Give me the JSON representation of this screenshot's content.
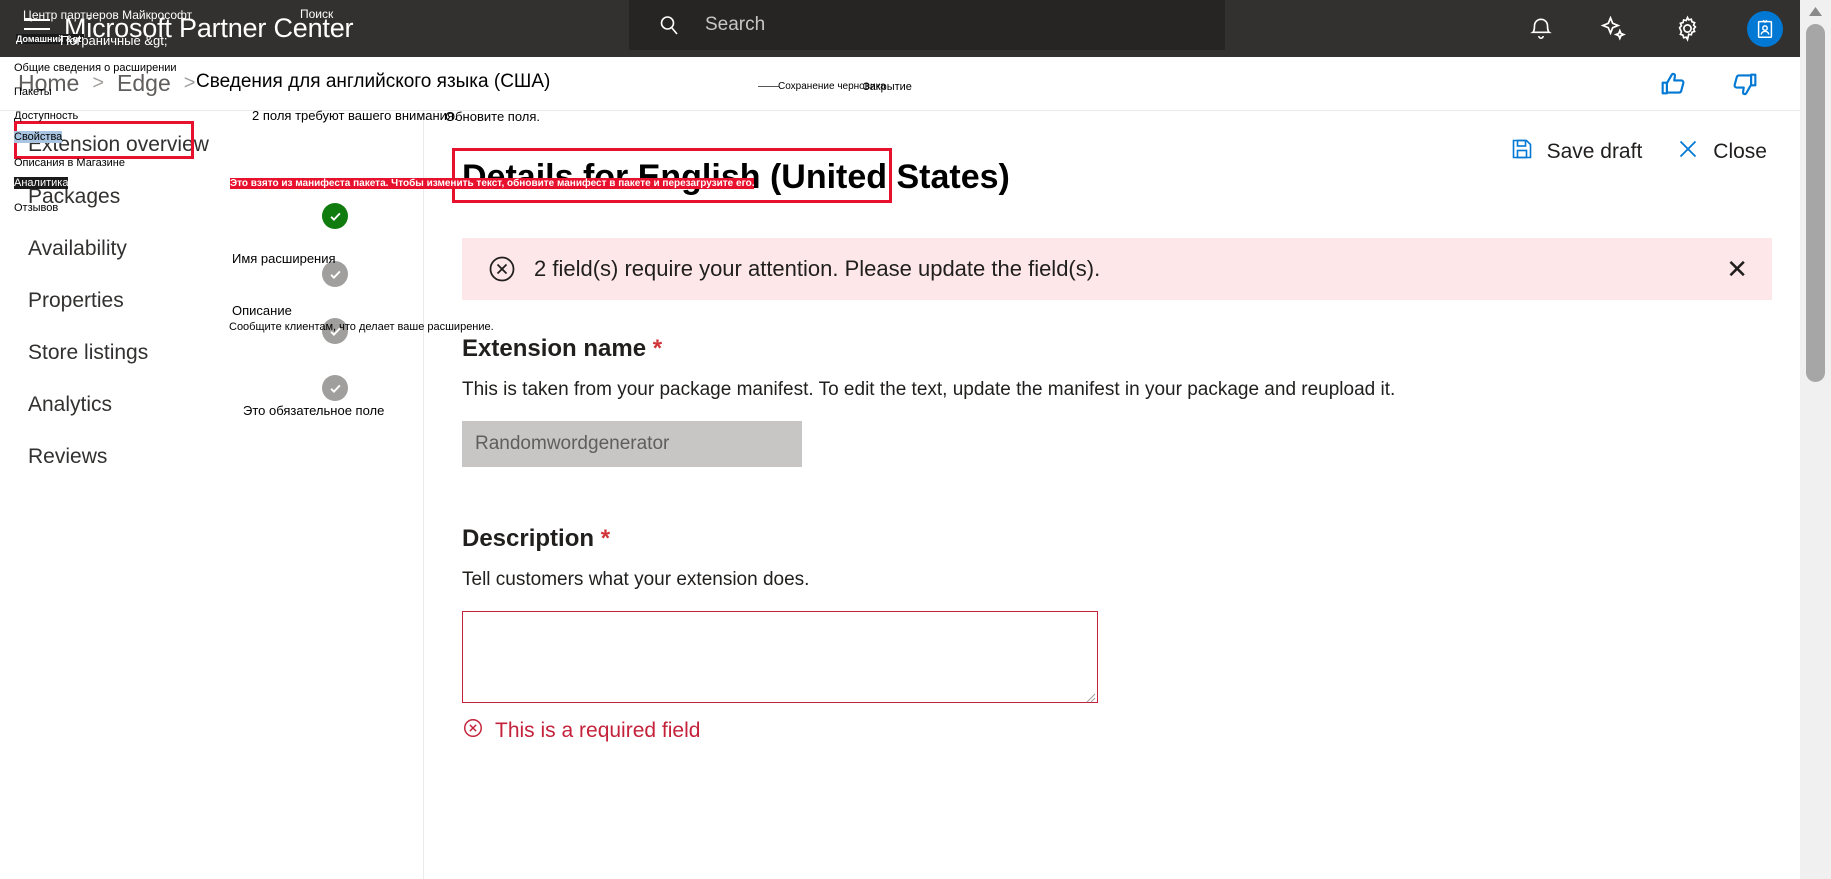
{
  "topbar": {
    "brand": "Microsoft Partner Center",
    "menu_icon": "hamburger-icon",
    "search": {
      "placeholder": "Search",
      "icon": "search-icon"
    },
    "icons": [
      {
        "name": "notifications-icon",
        "label": "Notifications"
      },
      {
        "name": "copilot-sparkle-icon",
        "label": "Copilot"
      },
      {
        "name": "settings-gear-icon",
        "label": "Settings"
      },
      {
        "name": "account-avatar-icon",
        "label": "Account"
      }
    ]
  },
  "breadcrumb": {
    "items": [
      {
        "label": "Home"
      },
      {
        "label": "Edge"
      },
      {
        "label": ""
      }
    ],
    "separator": ">",
    "feedback": [
      {
        "name": "thumbs-up-icon",
        "label": "Helpful"
      },
      {
        "name": "thumbs-down-icon",
        "label": "Not helpful"
      }
    ]
  },
  "sidebar": {
    "items": [
      {
        "label": "Extension overview"
      },
      {
        "label": "Packages"
      },
      {
        "label": "Availability"
      },
      {
        "label": "Properties"
      },
      {
        "label": "Store listings"
      },
      {
        "label": "Analytics"
      },
      {
        "label": "Reviews"
      }
    ]
  },
  "main": {
    "page_title": "Details for English (United States)",
    "commands": [
      {
        "label": "Save draft",
        "icon": "save-floppy-icon"
      },
      {
        "label": "Close",
        "icon": "close-x-icon"
      }
    ],
    "error_banner": {
      "icon": "error-circle-x-icon",
      "text": "2 field(s) require your attention. Please update the field(s).",
      "close": "✕"
    },
    "fields": [
      {
        "label": "Extension name",
        "required_mark": "*",
        "help": "This is taken from your package manifest. To edit the text, update the manifest in your package and reupload it.",
        "value": "Randomwordgenerator"
      },
      {
        "label": "Description",
        "required_mark": "*",
        "help": "Tell customers what your extension does.",
        "value": "",
        "error": "This is a required field",
        "error_icon": "error-circle-x-icon"
      }
    ],
    "status_circles": [
      {
        "state": "complete",
        "color": "#107c10"
      },
      {
        "state": "neutral",
        "color": "#a19f9d"
      },
      {
        "state": "neutral",
        "color": "#a19f9d"
      },
      {
        "state": "neutral",
        "color": "#a19f9d"
      }
    ]
  },
  "annotations_ru": [
    {
      "id": "a1",
      "text": "Центр партнеров Майкрософт"
    },
    {
      "id": "a2",
      "text": "Поиск"
    },
    {
      "id": "a3",
      "text": "Домашний &gt;"
    },
    {
      "id": "a4",
      "text": "Пограничные &gt;"
    },
    {
      "id": "a5",
      "text": "Общие сведения о расширении"
    },
    {
      "id": "a6",
      "text": "Сведения для английского языка (США)"
    },
    {
      "id": "a7",
      "text": "Пакеты"
    },
    {
      "id": "a8",
      "text": "Доступность"
    },
    {
      "id": "a9",
      "text": "Свойства"
    },
    {
      "id": "a10",
      "text": "Описания в Магазине"
    },
    {
      "id": "a11",
      "text": "Аналитика"
    },
    {
      "id": "a12",
      "text": "Отзывов"
    },
    {
      "id": "a13",
      "text": "2 поля требуют вашего внимания."
    },
    {
      "id": "a14",
      "text": "Обновите поля."
    },
    {
      "id": "a15",
      "text": "Имя расширения"
    },
    {
      "id": "a16",
      "text": "Это взято из манифеста пакета. Чтобы изменить текст, обновите манифест в пакете и перезагрузите его."
    },
    {
      "id": "a17",
      "text": "Описание"
    },
    {
      "id": "a18",
      "text": "Сообщите клиентам, что делает ваше расширение."
    },
    {
      "id": "a19",
      "text": "Это обязательное поле"
    },
    {
      "id": "a20",
      "text": "Сохранение черновика"
    },
    {
      "id": "a21",
      "text": "Закрытие"
    }
  ],
  "colors": {
    "topbar_bg": "#323130",
    "accent_blue": "#0078d4",
    "error_red": "#c4223b",
    "banner_bg": "#fde7e9",
    "annotation_red": "#e8112d",
    "success_green": "#107c10"
  }
}
